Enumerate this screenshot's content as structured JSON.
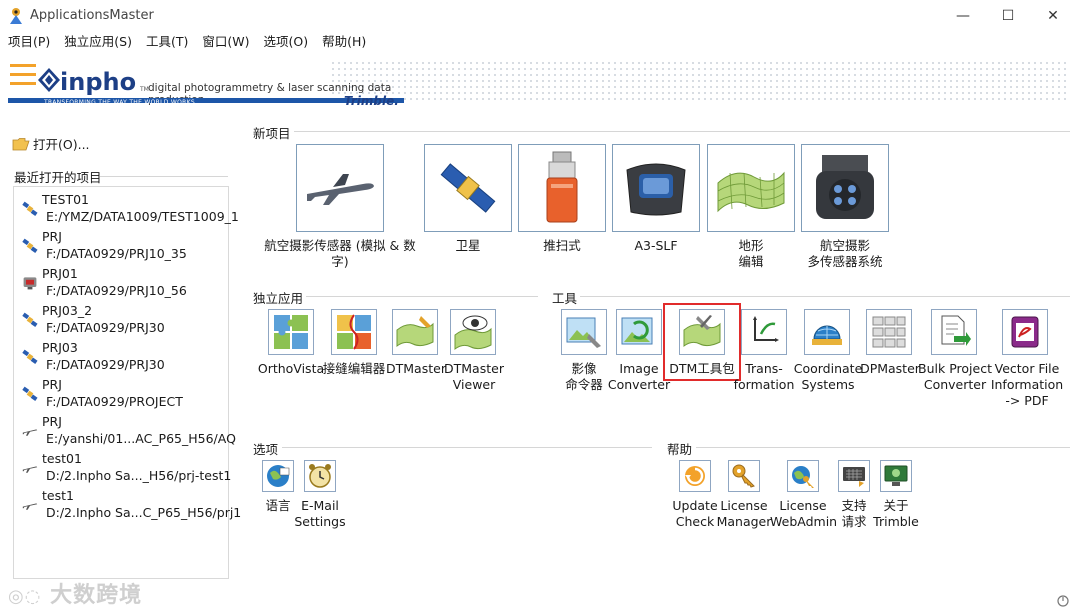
{
  "window": {
    "title": "ApplicationsMaster",
    "min": "—",
    "max": "☐",
    "close": "✕"
  },
  "menu": [
    "项目(P)",
    "独立应用(S)",
    "工具(T)",
    "窗口(W)",
    "选项(O)",
    "帮助(H)"
  ],
  "banner": {
    "brand": "inpho",
    "tm": "TM",
    "tagline": "digital photogrammetry & laser scanning data production",
    "strap": "TRANSFORMING THE WAY THE WORLD WORKS",
    "partner": "Trimble."
  },
  "left": {
    "open_label": "打开(O)...",
    "recent_title": "最近打开的项目",
    "recent": [
      {
        "name": "TEST01",
        "path": "E:/YMZ/DATA1009/TEST1009_1",
        "icon": "satellite-icon"
      },
      {
        "name": "PRJ",
        "path": "F:/DATA0929/PRJ10_35",
        "icon": "satellite-icon"
      },
      {
        "name": "PRJ01",
        "path": "F:/DATA0929/PRJ10_56",
        "icon": "scanner-icon"
      },
      {
        "name": "PRJ03_2",
        "path": "F:/DATA0929/PRJ30",
        "icon": "satellite-icon"
      },
      {
        "name": "PRJ03",
        "path": "F:/DATA0929/PRJ30",
        "icon": "satellite-icon"
      },
      {
        "name": "PRJ",
        "path": "F:/DATA0929/PROJECT",
        "icon": "satellite-icon"
      },
      {
        "name": "PRJ",
        "path": "E:/yanshi/01...AC_P65_H56/AQ",
        "icon": "airplane-icon"
      },
      {
        "name": "test01",
        "path": "D:/2.Inpho Sa..._H56/prj-test1",
        "icon": "airplane-icon"
      },
      {
        "name": "test1",
        "path": "D:/2.Inpho Sa...C_P65_H56/prj1",
        "icon": "airplane-icon"
      }
    ]
  },
  "sections": {
    "new_project": "新项目",
    "standalone": "独立应用",
    "tools": "工具",
    "options": "选项",
    "help": "帮助"
  },
  "new_project": [
    {
      "l1": "航空摄影传感器 (模拟 & 数字)",
      "l2": ""
    },
    {
      "l1": "卫星",
      "l2": ""
    },
    {
      "l1": "推扫式",
      "l2": ""
    },
    {
      "l1": "A3-SLF",
      "l2": ""
    },
    {
      "l1": "地形",
      "l2": "编辑"
    },
    {
      "l1": "航空摄影",
      "l2": "多传感器系统"
    }
  ],
  "standalone": [
    {
      "l1": "OrthoVista",
      "l2": ""
    },
    {
      "l1": "接缝编辑器",
      "l2": ""
    },
    {
      "l1": "DTMaster",
      "l2": ""
    },
    {
      "l1": "DTMaster",
      "l2": "Viewer"
    }
  ],
  "tools": [
    {
      "l1": "影像",
      "l2": "命令器",
      "l3": ""
    },
    {
      "l1": "Image",
      "l2": "Converter",
      "l3": ""
    },
    {
      "l1": "DTM工具包",
      "l2": "",
      "l3": ""
    },
    {
      "l1": "Trans-",
      "l2": "formation",
      "l3": ""
    },
    {
      "l1": "Coordinate",
      "l2": "Systems",
      "l3": ""
    },
    {
      "l1": "DPMaster",
      "l2": "",
      "l3": ""
    },
    {
      "l1": "Bulk Project",
      "l2": "Converter",
      "l3": ""
    },
    {
      "l1": "Vector File",
      "l2": "Information",
      "l3": "-> PDF"
    }
  ],
  "options": [
    {
      "l1": "语言",
      "l2": ""
    },
    {
      "l1": "E-Mail",
      "l2": "Settings"
    }
  ],
  "help": [
    {
      "l1": "Update",
      "l2": "Check"
    },
    {
      "l1": "License",
      "l2": "Manager"
    },
    {
      "l1": "License",
      "l2": "WebAdmin"
    },
    {
      "l1": "支持",
      "l2": "请求"
    },
    {
      "l1": "关于",
      "l2": "Trimble"
    }
  ],
  "watermark": "大数跨境",
  "colors": {
    "accent": "#1d56a8",
    "highlight": "#e12b2b",
    "tile_border": "#7f9db9"
  }
}
